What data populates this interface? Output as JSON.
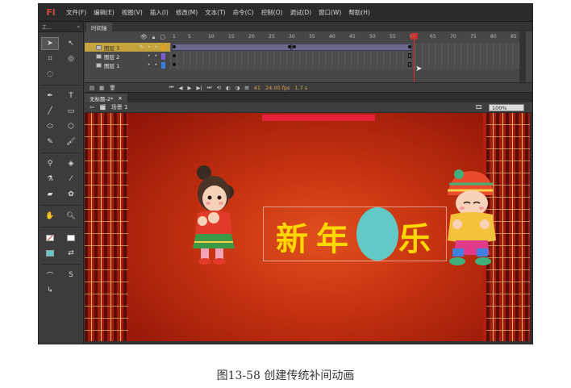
{
  "app": {
    "logo": "Fl",
    "menu": [
      "文件(F)",
      "编辑(E)",
      "视图(V)",
      "插入(I)",
      "修改(M)",
      "文本(T)",
      "命令(C)",
      "控制(O)",
      "调试(D)",
      "窗口(W)",
      "帮助(H)"
    ]
  },
  "toolbox": {
    "header": "工..."
  },
  "timeline": {
    "tab": "时间轴",
    "ruler": [
      "1",
      "5",
      "10",
      "15",
      "20",
      "25",
      "30",
      "35",
      "40",
      "45",
      "50",
      "55",
      "60",
      "65",
      "70",
      "75",
      "80",
      "85"
    ],
    "layers": [
      {
        "name": "图层 3",
        "color": "#e0a020"
      },
      {
        "name": "图层 2",
        "color": "#7b5cd6"
      },
      {
        "name": "图层 1",
        "color": "#3c7ee0"
      }
    ],
    "footer": {
      "frame": "41",
      "fps": "24.00 fps",
      "time": "1.7 s"
    }
  },
  "document": {
    "tab": "无标题-2*",
    "scene": "场景 1",
    "zoom": "100%"
  },
  "stage": {
    "greeting_chars": [
      "新",
      "年",
      "乐"
    ],
    "colors": {
      "background": "#c2300f",
      "text": "#ffd700",
      "blob": "#62c9c7"
    }
  },
  "caption": "图13-58 创建传统补间动画"
}
